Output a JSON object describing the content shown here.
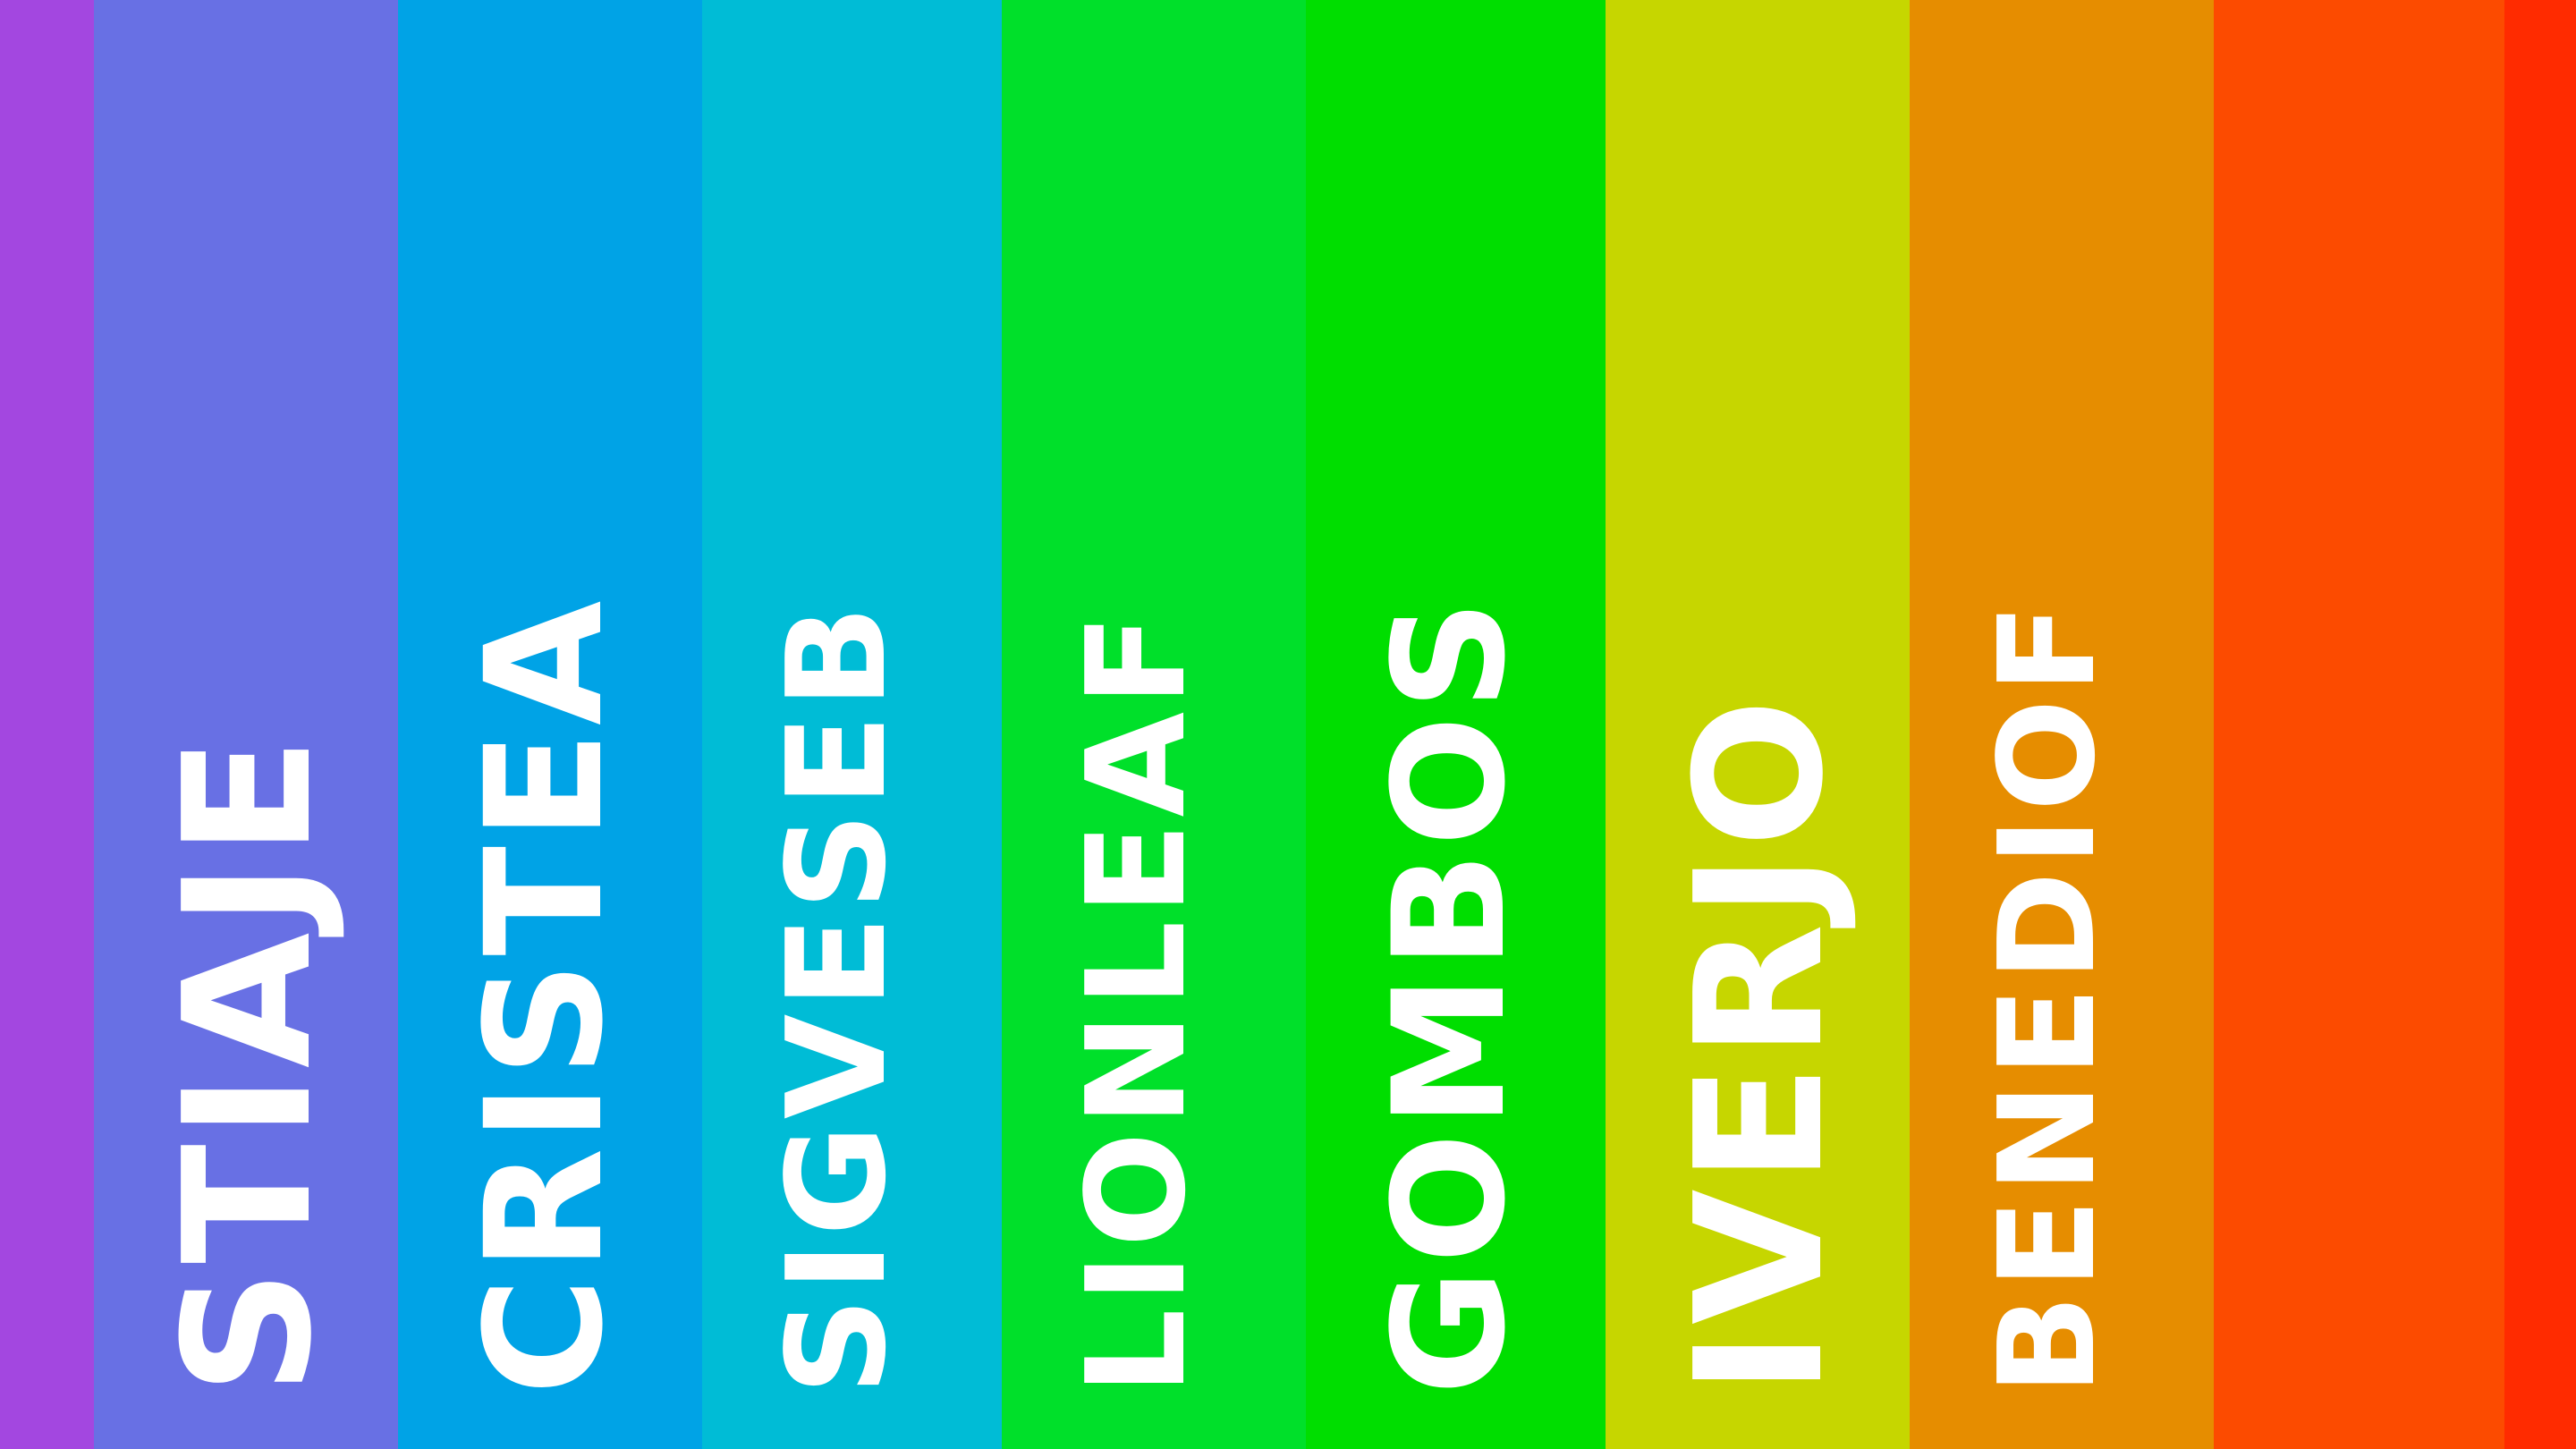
{
  "stripes": [
    {
      "color": "#a347e0"
    },
    {
      "color": "#6870e4"
    },
    {
      "color": "#00a3e6"
    },
    {
      "color": "#00bcd6"
    },
    {
      "color": "#00e02a"
    },
    {
      "color": "#00de00"
    },
    {
      "color": "#c6d600"
    },
    {
      "color": "#e68d00"
    },
    {
      "color": "#fc4b00"
    },
    {
      "color": "#ff2b00"
    }
  ],
  "words": [
    {
      "text": "STIAJE",
      "color": "#ffffff"
    },
    {
      "text": "CRISTEA",
      "color": "#ffffff"
    },
    {
      "text": "SIGVESEB",
      "color": "#ffffff"
    },
    {
      "text": "LIONLEAF",
      "color": "#ffffff"
    },
    {
      "text": "GOMBOS",
      "color": "#ffffff"
    },
    {
      "text": "IVERJO",
      "color": "#ffffff"
    },
    {
      "text": "BENEDIOF",
      "color": "#ffffff"
    }
  ]
}
